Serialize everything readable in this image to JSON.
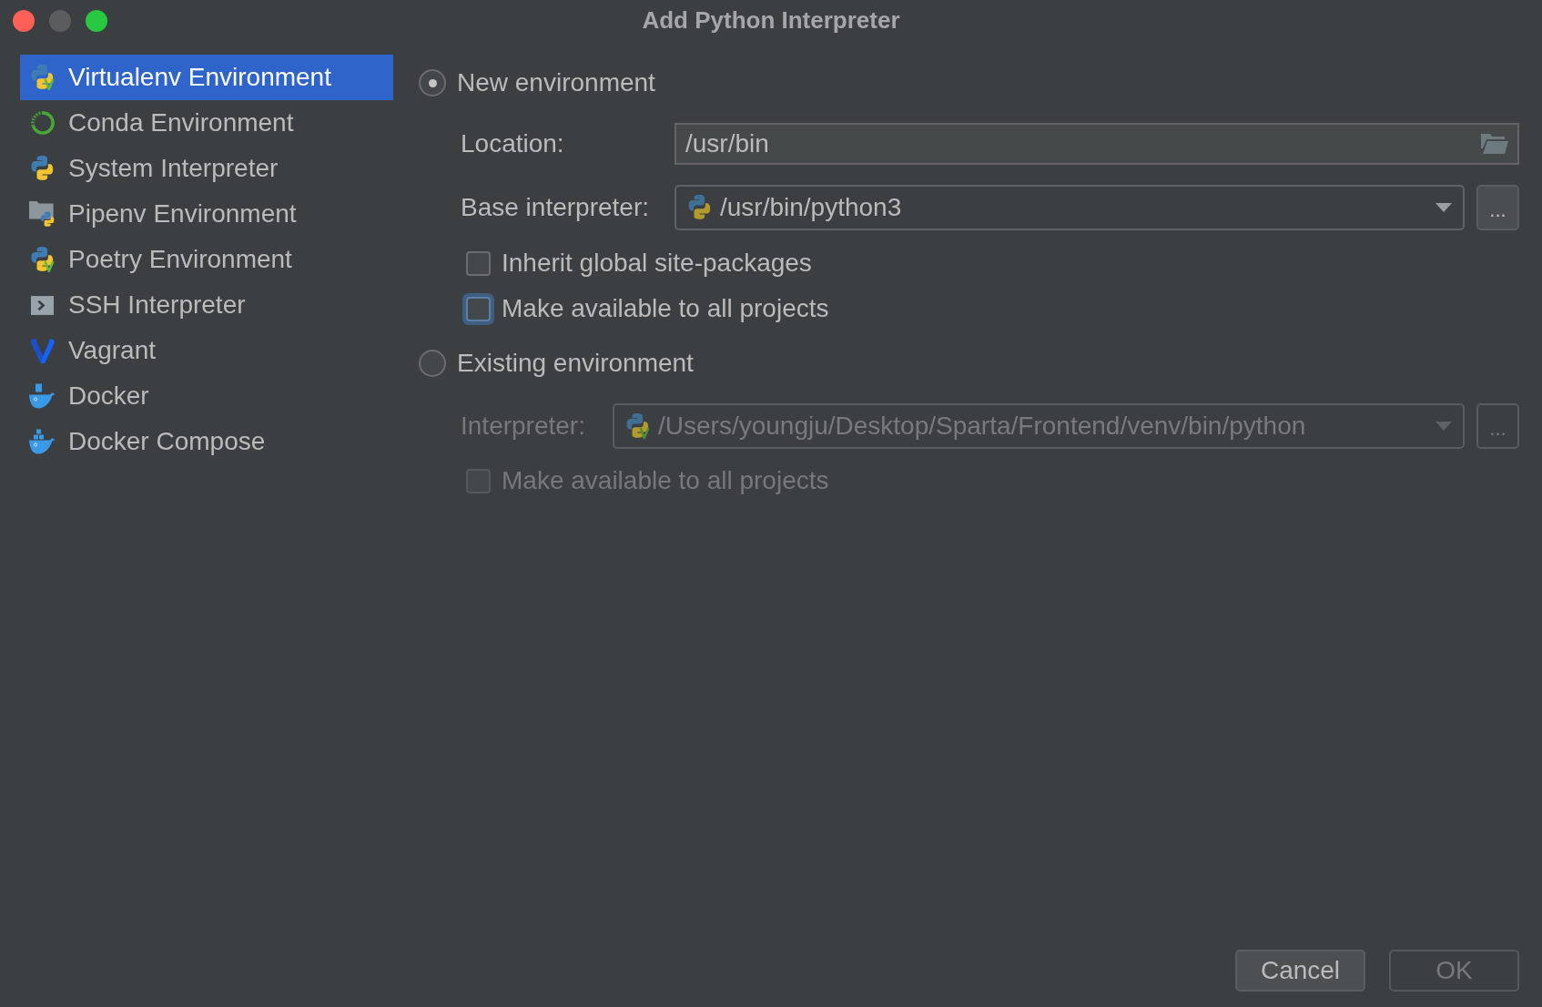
{
  "window": {
    "title": "Add Python Interpreter"
  },
  "sidebar": {
    "items": [
      {
        "label": "Virtualenv Environment",
        "kind": "virtualenv",
        "selected": true
      },
      {
        "label": "Conda Environment",
        "kind": "conda",
        "selected": false
      },
      {
        "label": "System Interpreter",
        "kind": "system",
        "selected": false
      },
      {
        "label": "Pipenv Environment",
        "kind": "pipenv",
        "selected": false
      },
      {
        "label": "Poetry Environment",
        "kind": "poetry",
        "selected": false
      },
      {
        "label": "SSH Interpreter",
        "kind": "ssh",
        "selected": false
      },
      {
        "label": "Vagrant",
        "kind": "vagrant",
        "selected": false
      },
      {
        "label": "Docker",
        "kind": "docker",
        "selected": false
      },
      {
        "label": "Docker Compose",
        "kind": "docker_compose",
        "selected": false
      }
    ]
  },
  "new_environment": {
    "label": "New environment",
    "selected": true,
    "location": {
      "label": "Location:",
      "value": "/usr/bin"
    },
    "base_interpreter": {
      "label": "Base interpreter:",
      "value": "/usr/bin/python3",
      "browse": "..."
    },
    "options": [
      {
        "label": "Inherit global site-packages",
        "checked": false,
        "focused": false
      },
      {
        "label": "Make available to all projects",
        "checked": false,
        "focused": true
      }
    ]
  },
  "existing_environment": {
    "label": "Existing environment",
    "selected": false,
    "interpreter": {
      "label": "Interpreter:",
      "value": "/Users/youngju/Desktop/Sparta/Frontend/venv/bin/python",
      "browse": "...",
      "disabled": true
    },
    "options": [
      {
        "label": "Make available to all projects",
        "checked": false,
        "focused": false,
        "disabled": true
      }
    ]
  },
  "buttons": [
    {
      "label": "Cancel",
      "disabled": false
    },
    {
      "label": "OK",
      "disabled": true
    }
  ]
}
